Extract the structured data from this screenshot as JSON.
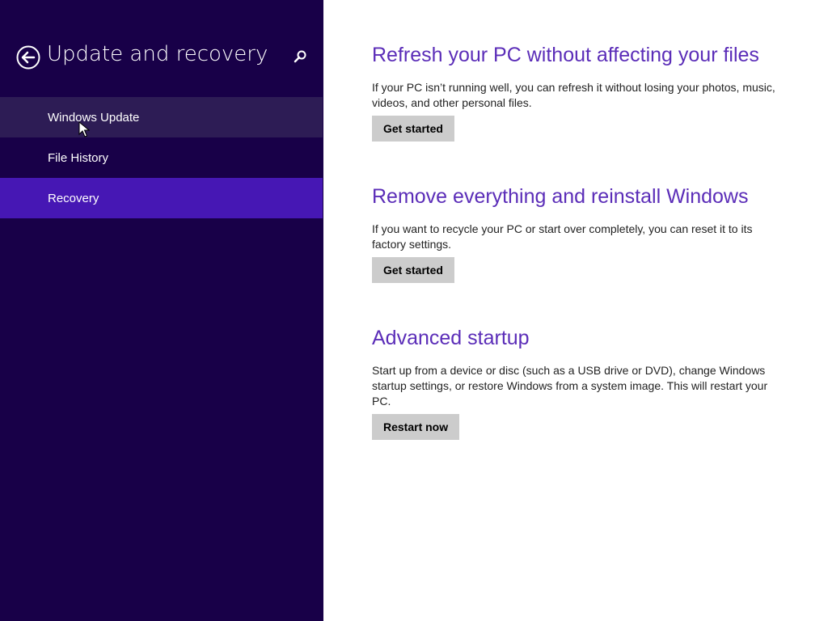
{
  "nav": {
    "title": "Update and recovery",
    "back_icon": "back-arrow-icon",
    "search_icon": "search-icon",
    "items": [
      {
        "label": "Windows Update",
        "state": "hover"
      },
      {
        "label": "File History",
        "state": "normal"
      },
      {
        "label": "Recovery",
        "state": "selected"
      }
    ]
  },
  "sections": [
    {
      "heading": "Refresh your PC without affecting your files",
      "description": "If your PC isn’t running well, you can refresh it without losing your photos, music, videos, and other personal files.",
      "button_label": "Get started"
    },
    {
      "heading": "Remove everything and reinstall Windows",
      "description": "If you want to recycle your PC or start over completely, you can reset it to its factory settings.",
      "button_label": "Get started"
    },
    {
      "heading": "Advanced startup",
      "description": "Start up from a device or disc (such as a USB drive or DVD), change Windows startup settings, or restore Windows from a system image. This will restart your PC.",
      "button_label": "Restart now"
    }
  ],
  "colors": {
    "nav_background": "#180048",
    "nav_hover": "#2d1c55",
    "nav_selected": "#4617b4",
    "heading": "#5b2db8",
    "button": "#cccccc"
  }
}
